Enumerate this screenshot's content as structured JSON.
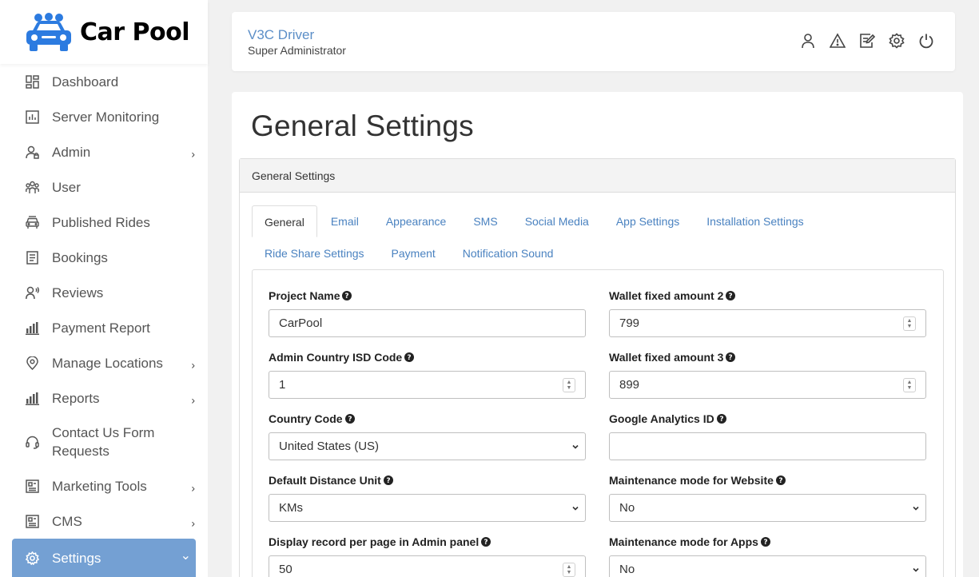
{
  "app": {
    "name": "Car Pool"
  },
  "sidebar": {
    "items": [
      {
        "label": "Dashboard",
        "icon": "dashboard-icon",
        "chevron": false
      },
      {
        "label": "Server Monitoring",
        "icon": "chart-icon",
        "chevron": false
      },
      {
        "label": "Admin",
        "icon": "admin-icon",
        "chevron": true
      },
      {
        "label": "User",
        "icon": "users-icon",
        "chevron": false
      },
      {
        "label": "Published Rides",
        "icon": "car-icon",
        "chevron": false
      },
      {
        "label": "Bookings",
        "icon": "document-icon",
        "chevron": false
      },
      {
        "label": "Reviews",
        "icon": "review-icon",
        "chevron": false
      },
      {
        "label": "Payment Report",
        "icon": "bar-chart-icon",
        "chevron": false
      },
      {
        "label": "Manage Locations",
        "icon": "location-icon",
        "chevron": true
      },
      {
        "label": "Reports",
        "icon": "bar-chart-icon",
        "chevron": true
      },
      {
        "label": "Contact Us Form Requests",
        "icon": "headset-icon",
        "chevron": false
      },
      {
        "label": "Marketing Tools",
        "icon": "newspaper-icon",
        "chevron": true
      },
      {
        "label": "CMS",
        "icon": "newspaper-icon",
        "chevron": true
      },
      {
        "label": "Settings",
        "icon": "gear-icon",
        "chevron": true,
        "active": true
      }
    ],
    "chevron_right": "›",
    "chevron_down": "⌄"
  },
  "header": {
    "user_name": "V3C Driver",
    "user_role": "Super Administrator",
    "icons": [
      "user-icon",
      "warning-icon",
      "edit-icon",
      "settings-icon",
      "power-icon"
    ]
  },
  "main": {
    "title": "General Settings",
    "panel_title": "General Settings",
    "tabs_row1": [
      "General",
      "Email",
      "Appearance",
      "SMS",
      "Social Media",
      "App Settings",
      "Installation Settings"
    ],
    "tabs_row2": [
      "Ride Share Settings",
      "Payment",
      "Notification Sound"
    ],
    "active_tab": "General",
    "fields": {
      "project_name": {
        "label": "Project Name",
        "value": "CarPool"
      },
      "admin_isd": {
        "label": "Admin Country ISD Code",
        "value": "1"
      },
      "country_code": {
        "label": "Country Code",
        "value": "United States (US)"
      },
      "distance_unit": {
        "label": "Default Distance Unit",
        "value": "KMs"
      },
      "records_per_page": {
        "label": "Display record per page in Admin panel",
        "value": "50"
      },
      "wallet_2": {
        "label": "Wallet fixed amount 2",
        "value": "799"
      },
      "wallet_3": {
        "label": "Wallet fixed amount 3",
        "value": "899"
      },
      "ga_id": {
        "label": "Google Analytics ID",
        "value": ""
      },
      "maint_web": {
        "label": "Maintenance mode for Website",
        "value": "No"
      },
      "maint_apps": {
        "label": "Maintenance mode for Apps",
        "value": "No"
      }
    }
  },
  "colors": {
    "accent": "#74a0d3",
    "link": "#4a82c0",
    "brand_blue": "#2c7be0"
  }
}
